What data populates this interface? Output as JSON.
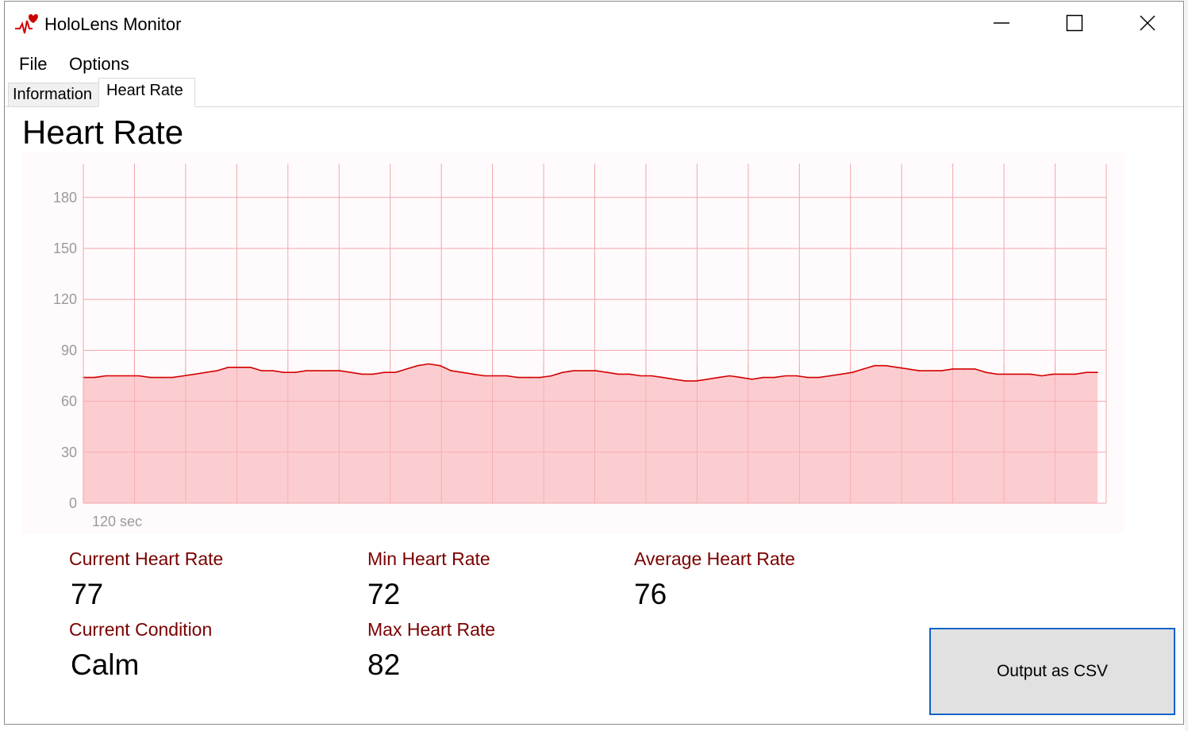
{
  "window": {
    "title": "HoloLens Monitor"
  },
  "icons": {
    "app": "heart-pulse-icon",
    "minimize": "minimize-icon",
    "maximize": "maximize-icon",
    "close": "close-icon"
  },
  "colors": {
    "accent": "#cc0000",
    "fill": "#fcc8cb",
    "label": "#7a0000",
    "button_border": "#0a64c8"
  },
  "menu": {
    "items": [
      {
        "label": "File"
      },
      {
        "label": "Options"
      }
    ]
  },
  "tabs": [
    {
      "label": "Information",
      "selected": false
    },
    {
      "label": "Heart Rate",
      "selected": true
    }
  ],
  "page": {
    "title": "Heart Rate"
  },
  "chart_data": {
    "type": "area",
    "title": "",
    "xlabel": "120 sec",
    "ylabel": "",
    "ylim": [
      0,
      200
    ],
    "yticks": [
      0,
      30,
      60,
      90,
      120,
      150,
      180
    ],
    "grid": true,
    "series": [
      {
        "values": [
          74,
          74,
          75,
          75,
          75,
          75,
          74,
          74,
          74,
          75,
          76,
          77,
          78,
          80,
          80,
          80,
          78,
          78,
          77,
          77,
          78,
          78,
          78,
          78,
          77,
          76,
          76,
          77,
          77,
          79,
          81,
          82,
          81,
          78,
          77,
          76,
          75,
          75,
          75,
          74,
          74,
          74,
          75,
          77,
          78,
          78,
          78,
          77,
          76,
          76,
          75,
          75,
          74,
          73,
          72,
          72,
          73,
          74,
          75,
          74,
          73,
          74,
          74,
          75,
          75,
          74,
          74,
          75,
          76,
          77,
          79,
          81,
          81,
          80,
          79,
          78,
          78,
          78,
          79,
          79,
          79,
          77,
          76,
          76,
          76,
          76,
          75,
          76,
          76,
          76,
          77,
          77
        ]
      }
    ]
  },
  "stats": {
    "current_hr_label": "Current Heart Rate",
    "current_hr_value": "77",
    "min_hr_label": "Min Heart Rate",
    "min_hr_value": "72",
    "avg_hr_label": "Average Heart Rate",
    "avg_hr_value": "76",
    "condition_label": "Current Condition",
    "condition_value": "Calm",
    "max_hr_label": "Max Heart Rate",
    "max_hr_value": "82"
  },
  "actions": {
    "csv_label": "Output as CSV"
  }
}
